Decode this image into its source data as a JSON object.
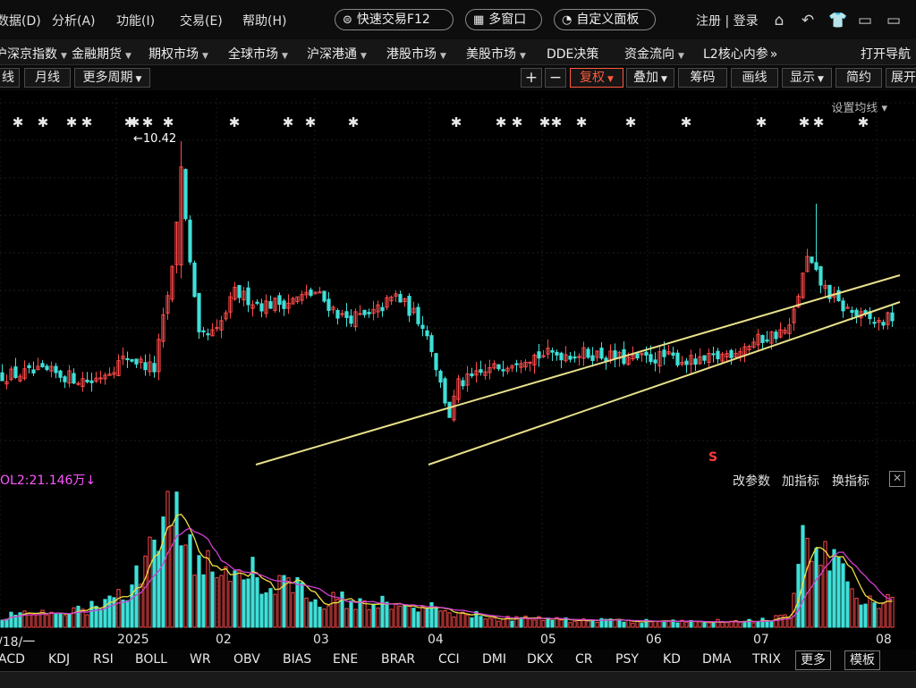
{
  "menubar": {
    "items": [
      "数据(D)",
      "分析(A)",
      "功能(I)",
      "交易(E)",
      "帮助(H)"
    ],
    "quick_trade": "快速交易F12",
    "multi_window": "多窗口",
    "custom_panel": "自定义面板",
    "login": "注册 | 登录"
  },
  "navbar": {
    "items": [
      "沪深京指数",
      "金融期货",
      "期权市场",
      "全球市场",
      "沪深港通",
      "港股市场",
      "美股市场",
      "DDE决策",
      "资金流向",
      "L2核心内参"
    ],
    "more": "»",
    "open_nav": "打开导航"
  },
  "toolbar": {
    "left": [
      "线",
      "月线",
      "更多周期"
    ],
    "plus": "+",
    "minus": "−",
    "fuquan": "复权",
    "overlay": "叠加",
    "chips": "筹码",
    "draw": "画线",
    "display": "显示",
    "simple": "简约",
    "expand": "展开"
  },
  "chart": {
    "set_ma": "设置均线",
    "max_label": "10.42",
    "s_marker": "S"
  },
  "volume_panel": {
    "label": "OL2:21.146万",
    "change_param": "改参数",
    "add_indicator": "加指标",
    "switch_indicator": "换指标",
    "close": "✕"
  },
  "date_axis": [
    "/18/一",
    "2025",
    "02",
    "03",
    "04",
    "05",
    "06",
    "07",
    "08"
  ],
  "indicators": [
    "ACD",
    "KDJ",
    "RSI",
    "BOLL",
    "WR",
    "OBV",
    "BIAS",
    "ENE",
    "BRAR",
    "CCI",
    "DMI",
    "DKX",
    "CR",
    "PSY",
    "KD",
    "DMA",
    "TRIX"
  ],
  "indicator_more": "更多",
  "indicator_template": "模板",
  "colors": {
    "up": "#ff4a4a",
    "down": "#3fe0d8",
    "trendline": "#e8e08a",
    "ma_yellow": "#f0e040",
    "ma_magenta": "#d040d0",
    "accent": "#ff5a3c"
  },
  "chart_data": {
    "type": "candlestick",
    "note_max": 10.42,
    "anchors_close": [
      [
        0,
        6.6
      ],
      [
        10,
        6.65
      ],
      [
        20,
        6.5
      ],
      [
        28,
        6.9
      ],
      [
        34,
        6.7
      ],
      [
        38,
        8.3
      ],
      [
        40,
        10.0
      ],
      [
        42,
        8.4
      ],
      [
        44,
        7.2
      ],
      [
        48,
        7.3
      ],
      [
        52,
        7.95
      ],
      [
        58,
        7.75
      ],
      [
        64,
        7.8
      ],
      [
        70,
        7.95
      ],
      [
        76,
        7.55
      ],
      [
        82,
        7.55
      ],
      [
        88,
        7.9
      ],
      [
        94,
        7.45
      ],
      [
        96,
        7.05
      ],
      [
        98,
        6.45
      ],
      [
        100,
        5.95
      ],
      [
        102,
        6.45
      ],
      [
        108,
        6.65
      ],
      [
        116,
        6.9
      ],
      [
        124,
        6.95
      ],
      [
        132,
        6.95
      ],
      [
        140,
        6.85
      ],
      [
        148,
        6.9
      ],
      [
        156,
        6.8
      ],
      [
        162,
        6.95
      ],
      [
        170,
        7.2
      ],
      [
        176,
        7.35
      ],
      [
        180,
        8.5
      ],
      [
        183,
        8.1
      ],
      [
        187,
        7.75
      ],
      [
        192,
        7.55
      ],
      [
        196,
        7.45
      ],
      [
        199,
        7.55
      ]
    ],
    "volume_anchors": [
      [
        0,
        0.08
      ],
      [
        16,
        0.11
      ],
      [
        24,
        0.18
      ],
      [
        30,
        0.35
      ],
      [
        33,
        0.55
      ],
      [
        36,
        0.95
      ],
      [
        38,
        1.0
      ],
      [
        40,
        0.75
      ],
      [
        44,
        0.5
      ],
      [
        50,
        0.45
      ],
      [
        56,
        0.4
      ],
      [
        60,
        0.25
      ],
      [
        64,
        0.35
      ],
      [
        70,
        0.2
      ],
      [
        80,
        0.2
      ],
      [
        90,
        0.15
      ],
      [
        96,
        0.18
      ],
      [
        100,
        0.12
      ],
      [
        110,
        0.07
      ],
      [
        130,
        0.05
      ],
      [
        150,
        0.04
      ],
      [
        170,
        0.05
      ],
      [
        176,
        0.08
      ],
      [
        180,
        0.75
      ],
      [
        184,
        0.55
      ],
      [
        188,
        0.35
      ],
      [
        194,
        0.2
      ],
      [
        199,
        0.18
      ]
    ]
  }
}
